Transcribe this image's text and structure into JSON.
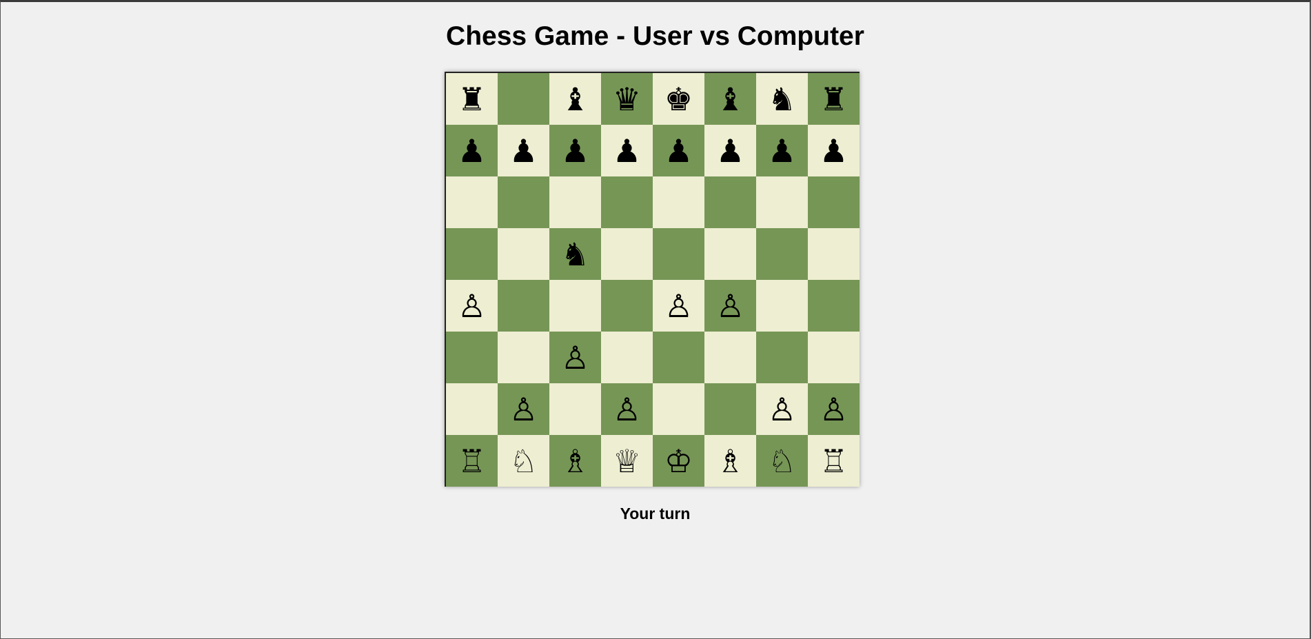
{
  "title": "Chess Game - User vs Computer",
  "status": "Your turn",
  "colors": {
    "light_square": "#eeeed2",
    "dark_square": "#769656",
    "background": "#f0f0f0"
  },
  "board": [
    [
      "♜",
      "",
      "♝",
      "♛",
      "♚",
      "♝",
      "♞",
      "♜"
    ],
    [
      "♟",
      "♟",
      "♟",
      "♟",
      "♟",
      "♟",
      "♟",
      "♟"
    ],
    [
      "",
      "",
      "",
      "",
      "",
      "",
      "",
      ""
    ],
    [
      "",
      "",
      "♞",
      "",
      "",
      "",
      "",
      ""
    ],
    [
      "♙",
      "",
      "",
      "",
      "♙",
      "♙",
      "",
      ""
    ],
    [
      "",
      "",
      "♙",
      "",
      "",
      "",
      "",
      ""
    ],
    [
      "",
      "♙",
      "",
      "♙",
      "",
      "",
      "♙",
      "♙"
    ],
    [
      "♖",
      "♘",
      "♗",
      "♕",
      "♔",
      "♗",
      "♘",
      "♖"
    ]
  ],
  "pieces": [
    [
      "black-rook",
      "",
      "black-bishop",
      "black-queen",
      "black-king",
      "black-bishop",
      "black-knight",
      "black-rook"
    ],
    [
      "black-pawn",
      "black-pawn",
      "black-pawn",
      "black-pawn",
      "black-pawn",
      "black-pawn",
      "black-pawn",
      "black-pawn"
    ],
    [
      "",
      "",
      "",
      "",
      "",
      "",
      "",
      ""
    ],
    [
      "",
      "",
      "black-knight",
      "",
      "",
      "",
      "",
      ""
    ],
    [
      "white-pawn",
      "",
      "",
      "",
      "white-pawn",
      "white-pawn",
      "",
      ""
    ],
    [
      "",
      "",
      "white-pawn",
      "",
      "",
      "",
      "",
      ""
    ],
    [
      "",
      "white-pawn",
      "",
      "white-pawn",
      "",
      "",
      "white-pawn",
      "white-pawn"
    ],
    [
      "white-rook",
      "white-knight",
      "white-bishop",
      "white-queen",
      "white-king",
      "white-bishop",
      "white-knight",
      "white-rook"
    ]
  ]
}
